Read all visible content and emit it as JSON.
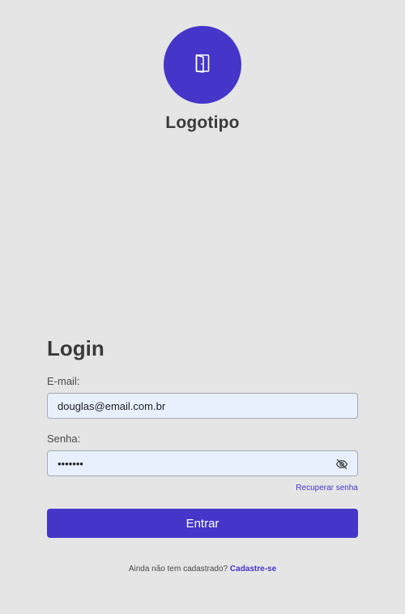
{
  "brand": {
    "logo_icon": "door-icon",
    "logo_text": "Logotipo",
    "accent_color": "#4536c9"
  },
  "login": {
    "title": "Login",
    "email_label": "E-mail:",
    "email_value": "douglas@email.com.br",
    "password_label": "Senha:",
    "password_value": "•••••••",
    "password_toggle_icon": "eye-slash-icon",
    "recover_label": "Recuperar senha",
    "submit_label": "Entrar",
    "signup_prompt": "Ainda não tem cadastrado?",
    "signup_label": "Cadastre-se"
  }
}
